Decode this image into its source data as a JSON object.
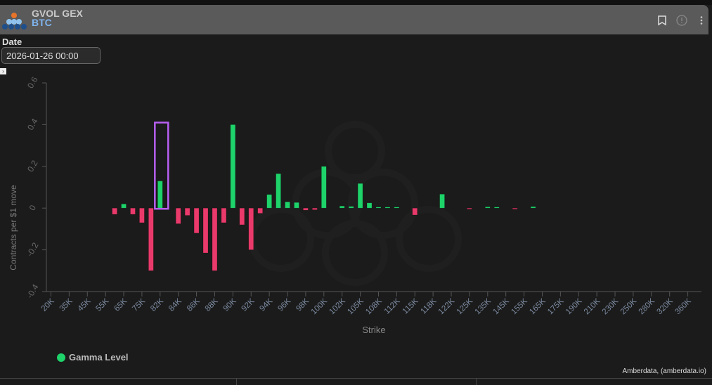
{
  "header": {
    "title": "GVOL GEX",
    "subtitle": "BTC",
    "icons": [
      "bookmark-icon",
      "info-icon",
      "more-vertical-icon"
    ]
  },
  "filters": {
    "date_label": "Date",
    "date_value": "2026-01-26 00:00"
  },
  "legend": {
    "label": "Gamma Level"
  },
  "credit": "Amberdata, (amberdata.io)",
  "colors": {
    "positive": "#1ed36a",
    "negative": "#ea3a6b",
    "highlight": "#b760f0",
    "header_bg": "#5a5a5a"
  },
  "chart_data": {
    "type": "bar",
    "xlabel": "Strike",
    "ylabel": "Contracts per $1 move",
    "ylim": [
      -0.4,
      0.6
    ],
    "yticks": [
      "0.6",
      "0.4",
      "0.2",
      "0",
      "-0.2",
      "-0.4"
    ],
    "ytick_values": [
      0.6,
      0.4,
      0.2,
      0,
      -0.2,
      -0.4
    ],
    "categories": [
      "20K",
      "",
      "35K",
      "",
      "45K",
      "",
      "55K",
      "",
      "65K",
      "",
      "75K",
      "",
      "82K",
      "",
      "84K",
      "",
      "86K",
      "",
      "88K",
      "",
      "90K",
      "",
      "92K",
      "",
      "94K",
      "",
      "96K",
      "",
      "98K",
      "",
      "100K",
      "",
      "102K",
      "",
      "105K",
      "",
      "108K",
      "",
      "112K",
      "",
      "115K",
      "",
      "118K",
      "",
      "122K",
      "",
      "125K",
      "",
      "135K",
      "",
      "145K",
      "",
      "155K",
      "",
      "165K",
      "",
      "175K",
      "",
      "190K",
      "",
      "210K",
      "",
      "230K",
      "",
      "250K",
      "",
      "280K",
      "",
      "320K",
      "",
      "360K",
      ""
    ],
    "values": [
      0,
      0,
      0,
      0,
      0,
      0,
      0,
      -0.03,
      0.02,
      -0.03,
      -0.07,
      -0.3,
      0.13,
      0,
      -0.075,
      -0.035,
      -0.12,
      -0.215,
      -0.3,
      -0.07,
      0.4,
      -0.08,
      -0.2,
      -0.025,
      0.065,
      0.165,
      0.03,
      0.027,
      -0.01,
      -0.008,
      0.2,
      0,
      0.01,
      0.008,
      0.118,
      0.025,
      0.004,
      0.004,
      0.004,
      0,
      -0.033,
      0,
      0,
      0.067,
      0,
      0,
      -0.004,
      0,
      0.006,
      0.004,
      0,
      -0.004,
      0,
      0.007,
      0,
      0,
      0,
      0,
      0,
      0,
      0,
      0,
      0,
      0,
      0,
      0,
      0,
      0,
      0,
      0,
      0,
      0
    ],
    "highlighted_category": "82K",
    "legend_position": "bottom-left"
  }
}
